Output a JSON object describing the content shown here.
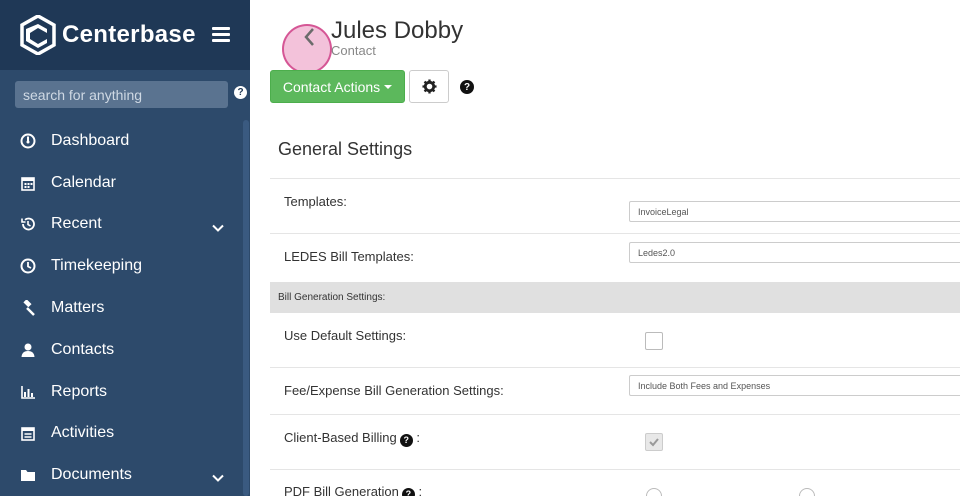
{
  "app": {
    "brand_name": "Centerbase",
    "search_placeholder": "search for anything",
    "help_symbol": "?"
  },
  "sidebar": {
    "items": [
      {
        "label": "Dashboard",
        "icon": "dashboard-icon",
        "has_submenu": false
      },
      {
        "label": "Calendar",
        "icon": "calendar-icon",
        "has_submenu": false
      },
      {
        "label": "Recent",
        "icon": "history-icon",
        "has_submenu": true
      },
      {
        "label": "Timekeeping",
        "icon": "clock-icon",
        "has_submenu": false
      },
      {
        "label": "Matters",
        "icon": "gavel-icon",
        "has_submenu": false
      },
      {
        "label": "Contacts",
        "icon": "contact-icon",
        "has_submenu": false
      },
      {
        "label": "Reports",
        "icon": "bar-chart-icon",
        "has_submenu": false
      },
      {
        "label": "Activities",
        "icon": "calendar-list-icon",
        "has_submenu": false
      },
      {
        "label": "Documents",
        "icon": "folder-icon",
        "has_submenu": true
      }
    ]
  },
  "header": {
    "contact_name": "Jules Dobby",
    "contact_type": "Contact",
    "actions_label": "Contact Actions",
    "help_symbol": "?"
  },
  "settings": {
    "section_title": "General Settings",
    "templates_label": "Templates:",
    "templates_value": "InvoiceLegal",
    "ledes_label": "LEDES Bill Templates:",
    "ledes_value": "Ledes2.0",
    "band_label": "Bill Generation Settings:",
    "use_default_label": "Use Default Settings:",
    "use_default_checked": false,
    "fee_expense_label": "Fee/Expense Bill Generation Settings:",
    "fee_expense_value": "Include Both Fees and Expenses",
    "client_billing_label": "Client-Based Billing",
    "client_billing_suffix": ":",
    "client_billing_checked": true,
    "pdf_label": "PDF Bill Generation",
    "pdf_suffix": ":"
  },
  "colors": {
    "sidebar_bg": "#2d4a6b",
    "brand_bg": "#1f3856",
    "primary_green": "#5cb85c",
    "band_gray": "#e0e0e0"
  }
}
